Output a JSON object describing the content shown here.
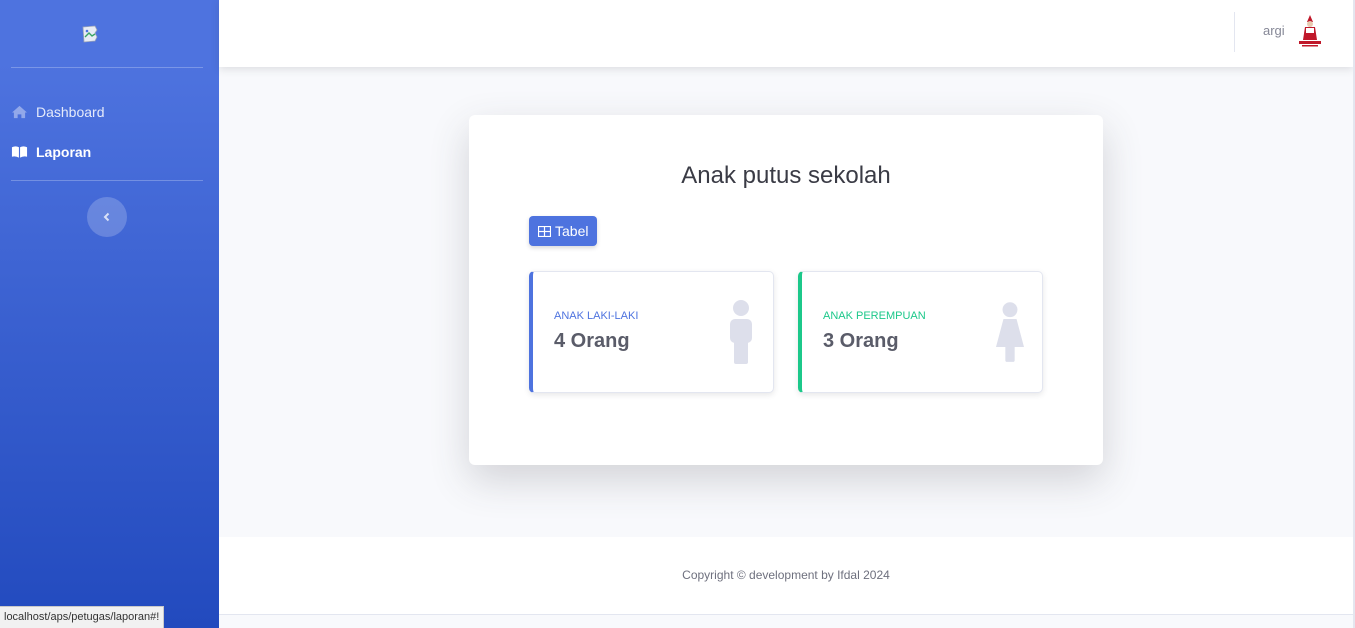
{
  "sidebar": {
    "logo_icon": "broken-image-icon",
    "items": [
      {
        "label": "Dashboard",
        "icon": "home-icon",
        "active": false
      },
      {
        "label": "Laporan",
        "icon": "book-open-icon",
        "active": true
      }
    ],
    "toggle_icon": "chevron-left-icon"
  },
  "topbar": {
    "username": "argi",
    "avatar_icon": "user-avatar-icon"
  },
  "main": {
    "title": "Anak putus sekolah",
    "tabel_button": {
      "label": "Tabel",
      "icon": "table-icon"
    },
    "cards": [
      {
        "label": "ANAK LAKI-LAKI",
        "value": "4 Orang",
        "icon": "male-icon",
        "accent": "#4e73df"
      },
      {
        "label": "ANAK PEREMPUAN",
        "value": "3 Orang",
        "icon": "female-icon",
        "accent": "#1cc88a"
      }
    ]
  },
  "footer": {
    "copyright": "Copyright © development by Ifdal 2024"
  },
  "status_bar": {
    "url": "localhost/aps/petugas/laporan#!"
  },
  "colors": {
    "primary": "#4e73df",
    "success": "#1cc88a",
    "sidebar_gradient_end": "#224abe",
    "background": "#f8f9fc"
  }
}
